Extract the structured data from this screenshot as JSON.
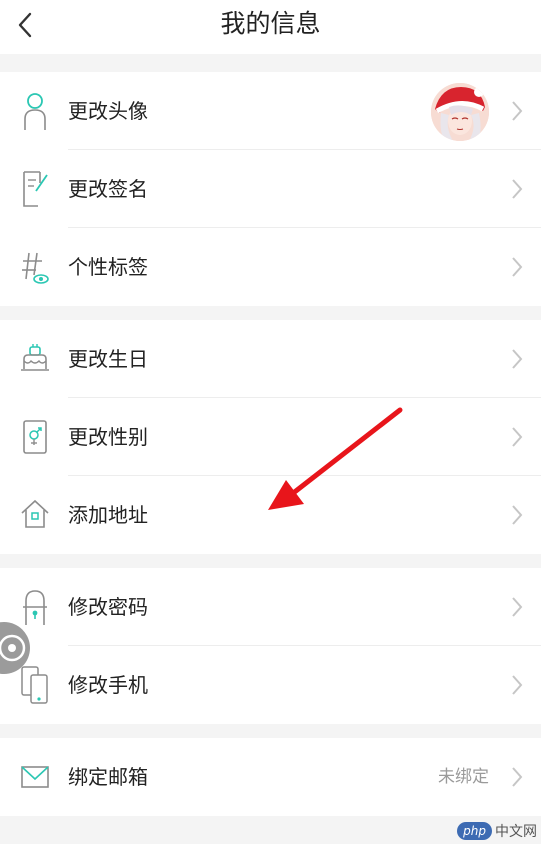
{
  "header": {
    "title": "我的信息"
  },
  "groups": [
    {
      "items": [
        {
          "label": "更改头像",
          "icon": "person-icon"
        },
        {
          "label": "更改签名",
          "icon": "signature-icon"
        },
        {
          "label": "个性标签",
          "icon": "tag-icon"
        }
      ]
    },
    {
      "items": [
        {
          "label": "更改生日",
          "icon": "cake-icon"
        },
        {
          "label": "更改性别",
          "icon": "gender-icon"
        },
        {
          "label": "添加地址",
          "icon": "house-icon"
        }
      ]
    },
    {
      "items": [
        {
          "label": "修改密码",
          "icon": "lock-icon"
        },
        {
          "label": "修改手机",
          "icon": "phone-icon"
        }
      ]
    },
    {
      "items": [
        {
          "label": "绑定邮箱",
          "icon": "mail-icon",
          "value": "未绑定"
        }
      ]
    }
  ],
  "watermark": {
    "logo": "php",
    "text": "中文网"
  },
  "colors": {
    "accent": "#2bc7b3",
    "icon_gray": "#8c8c8c",
    "arrow": "#e8151b"
  }
}
